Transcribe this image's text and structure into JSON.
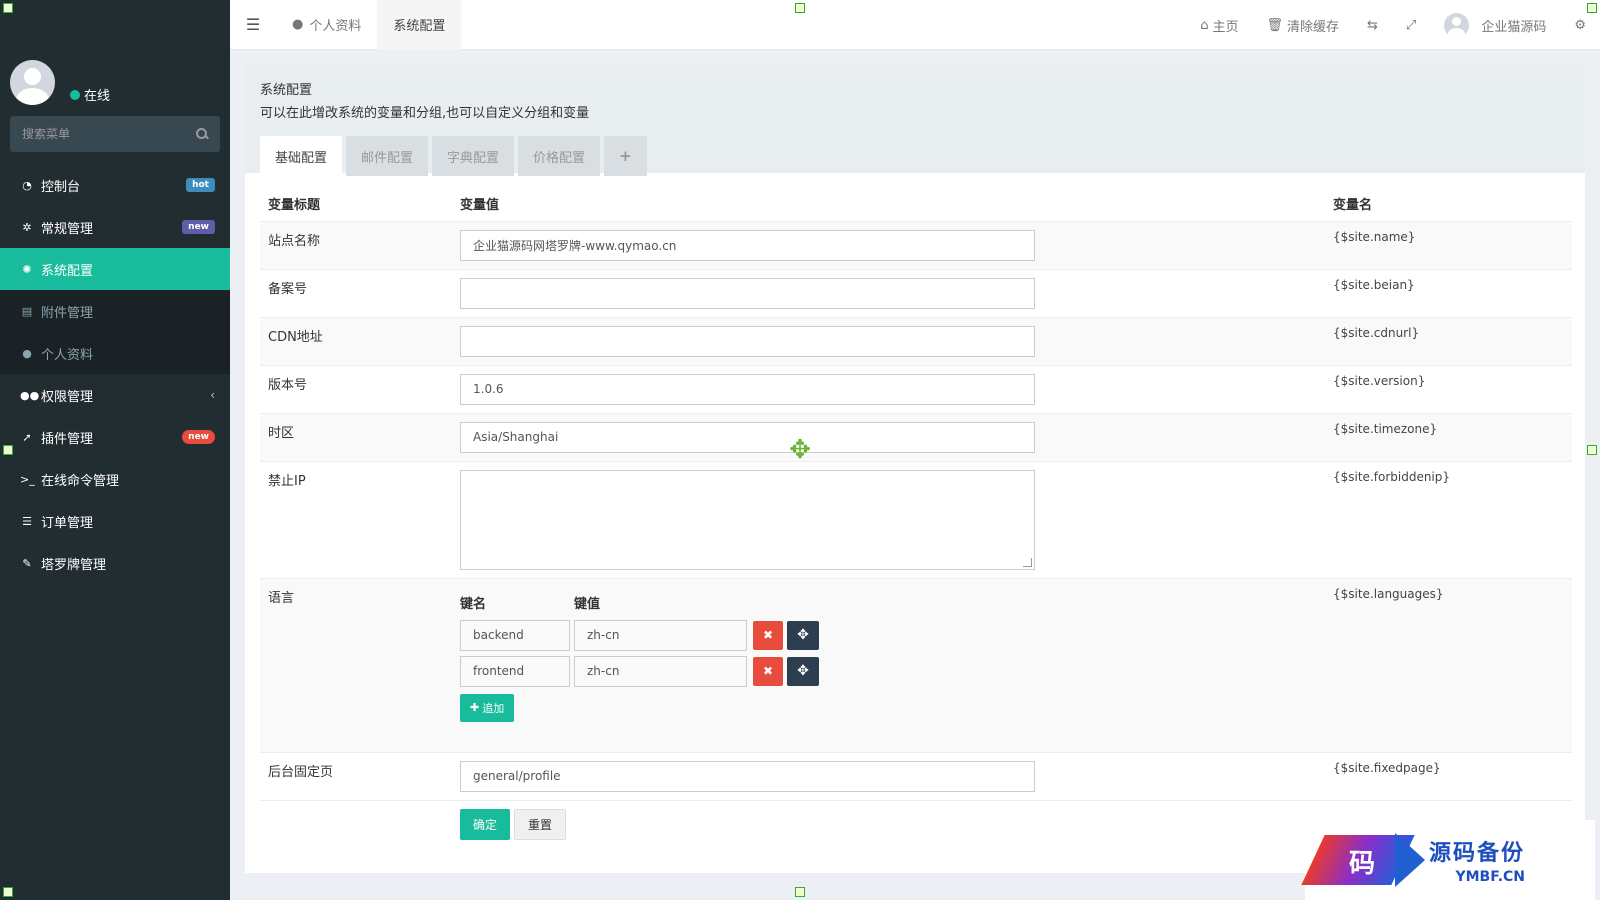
{
  "sidebar": {
    "status": "在线",
    "search_placeholder": "搜索菜单",
    "items": [
      {
        "label": "控制台",
        "icon": "dashboard-icon",
        "badge": "hot"
      },
      {
        "label": "常规管理",
        "icon": "cogs-icon",
        "badge": "new"
      },
      {
        "label": "系统配置",
        "icon": "gear-icon"
      },
      {
        "label": "附件管理",
        "icon": "file-image-icon"
      },
      {
        "label": "个人资料",
        "icon": "user-icon"
      },
      {
        "label": "权限管理",
        "icon": "group-icon"
      },
      {
        "label": "插件管理",
        "icon": "rocket-icon",
        "badge": "new"
      },
      {
        "label": "在线命令管理",
        "icon": "terminal-icon"
      },
      {
        "label": "订单管理",
        "icon": "list-icon"
      },
      {
        "label": "塔罗牌管理",
        "icon": "pencil-icon"
      }
    ]
  },
  "topbar": {
    "tabs": [
      "个人资料",
      "系统配置"
    ],
    "home": "主页",
    "clear_cache": "清除缓存",
    "username": "企业猫源码"
  },
  "page": {
    "title": "系统配置",
    "description": "可以在此增改系统的变量和分组,也可以自定义分组和变量",
    "tabs": [
      "基础配置",
      "邮件配置",
      "字典配置",
      "价格配置",
      "+"
    ]
  },
  "table": {
    "headers": [
      "变量标题",
      "变量值",
      "变量名"
    ],
    "rows": [
      {
        "title": "站点名称",
        "value": "企业猫源码网塔罗牌-www.qymao.cn",
        "name": "{$site.name}"
      },
      {
        "title": "备案号",
        "value": "",
        "name": "{$site.beian}"
      },
      {
        "title": "CDN地址",
        "value": "",
        "name": "{$site.cdnurl}"
      },
      {
        "title": "版本号",
        "value": "1.0.6",
        "name": "{$site.version}"
      },
      {
        "title": "时区",
        "value": "Asia/Shanghai",
        "name": "{$site.timezone}"
      },
      {
        "title": "禁止IP",
        "value": "",
        "name": "{$site.forbiddenip}"
      },
      {
        "title": "语言",
        "name": "{$site.languages}"
      },
      {
        "title": "后台固定页",
        "value": "general/profile",
        "name": "{$site.fixedpage}"
      }
    ],
    "languages": {
      "key_header": "键名",
      "value_header": "键值",
      "pairs": [
        {
          "key": "backend",
          "value": "zh-cn"
        },
        {
          "key": "frontend",
          "value": "zh-cn"
        }
      ],
      "add_label": "追加"
    },
    "submit_label": "确定",
    "reset_label": "重置"
  },
  "watermark": {
    "char": "码",
    "cn": "源码备份",
    "en": "YMBF.CN"
  }
}
